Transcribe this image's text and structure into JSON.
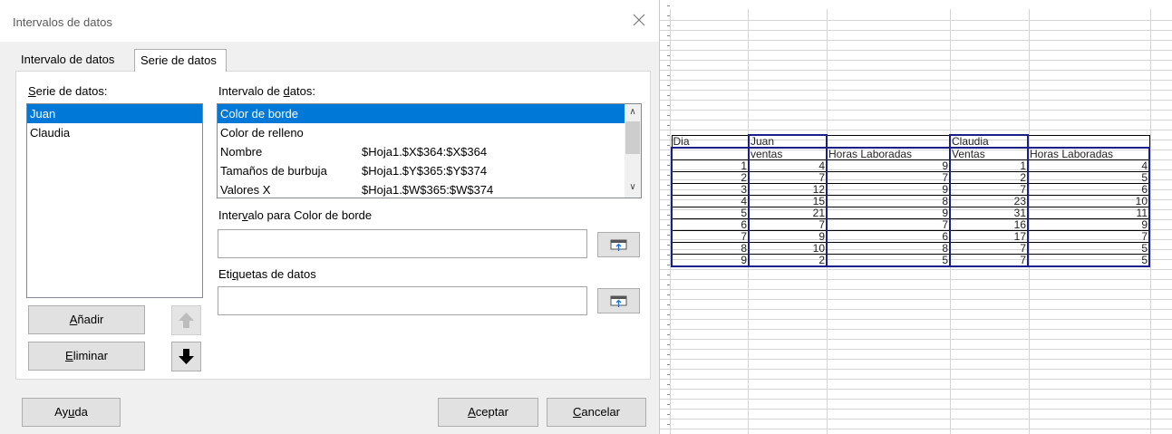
{
  "dialog": {
    "title": "Intervalos de datos",
    "tabs": [
      {
        "label": "Intervalo de datos",
        "active": false
      },
      {
        "label": "Serie de datos",
        "active": true
      }
    ],
    "series_label_pre": "",
    "series_label_mn": "S",
    "series_label_post": "erie de datos:",
    "series": [
      "Juan",
      "Claudia"
    ],
    "series_selected": "Juan",
    "ranges_label_pre": "Intervalo de ",
    "ranges_label_mn": "d",
    "ranges_label_post": "atos:",
    "ranges": [
      {
        "name": "Color de borde",
        "value": ""
      },
      {
        "name": "Color de relleno",
        "value": ""
      },
      {
        "name": "Nombre",
        "value": "$Hoja1.$X$364:$X$364"
      },
      {
        "name": "Tamaños de burbuja",
        "value": "$Hoja1.$Y$365:$Y$374"
      },
      {
        "name": "Valores X",
        "value": "$Hoja1.$W$365:$W$374"
      }
    ],
    "range_for_label_pre": "Inter",
    "range_for_label_mn": "v",
    "range_for_label_post": "alo para Color de borde",
    "range_for_value": "",
    "data_labels_pre": "Eti",
    "data_labels_mn": "q",
    "data_labels_post": "uetas de datos",
    "data_labels_value": "",
    "buttons": {
      "add": {
        "pre": "",
        "mn": "A",
        "post": "ñadir"
      },
      "remove": {
        "pre": "",
        "mn": "E",
        "post": "liminar"
      },
      "help": {
        "pre": "Ay",
        "mn": "u",
        "post": "da"
      },
      "ok": {
        "pre": "",
        "mn": "A",
        "post": "ceptar"
      },
      "cancel": {
        "pre": "",
        "mn": "C",
        "post": "ancelar"
      }
    },
    "icons": {
      "close": "close-icon",
      "up": "arrow-up-icon",
      "down": "arrow-down-icon",
      "shrink": "shrink-icon"
    }
  },
  "sheet": {
    "header": [
      "Dia",
      "Juan",
      "",
      "Claudia",
      ""
    ],
    "subheader": [
      "",
      "ventas",
      "Horas Laboradas",
      "Ventas",
      "Horas Laboradas"
    ],
    "rows": [
      [
        "1",
        "4",
        "9",
        "1",
        "4"
      ],
      [
        "2",
        "7",
        "7",
        "2",
        "5"
      ],
      [
        "3",
        "12",
        "9",
        "7",
        "6"
      ],
      [
        "4",
        "15",
        "8",
        "23",
        "10"
      ],
      [
        "5",
        "21",
        "9",
        "31",
        "11"
      ],
      [
        "6",
        "7",
        "7",
        "16",
        "9"
      ],
      [
        "7",
        "9",
        "6",
        "17",
        "7"
      ],
      [
        "8",
        "10",
        "8",
        "7",
        "5"
      ],
      [
        "9",
        "2",
        "5",
        "7",
        "5"
      ]
    ],
    "range_border_color": "#1b1f8a"
  },
  "colors": {
    "selection": "#0078d7",
    "dialog_bg": "#f0f0f0"
  }
}
